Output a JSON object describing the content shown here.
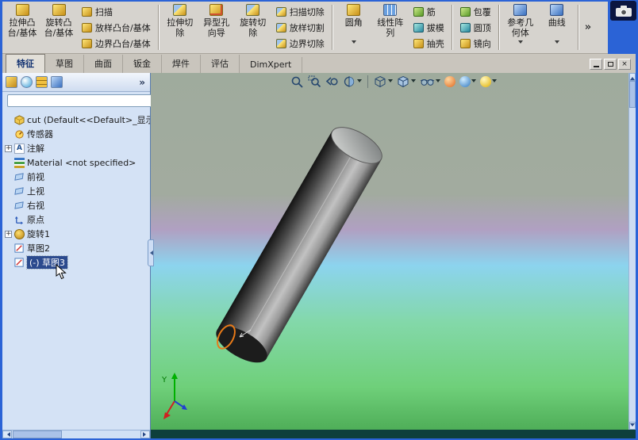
{
  "colors": {
    "window_border": "#2b63d6",
    "ribbon_bg": "#d6d3ce",
    "panel_bg": "#d4e2f5",
    "selection_bg": "#2b4a8e",
    "viewport_gradient": [
      "#9fab9d",
      "#b0a0c2",
      "#8cd4ee",
      "#6fd07a"
    ],
    "sketch_orange": "#e87a18",
    "cylinder_gray": "#8a8a8a"
  },
  "ribbon": {
    "buttons": {
      "extrude_boss": {
        "line1": "拉伸凸",
        "line2": "台/基体"
      },
      "revolve_boss": {
        "line1": "旋转凸",
        "line2": "台/基体"
      },
      "sweep": "扫描",
      "loft": "放样凸台/基体",
      "boundary": "边界凸台/基体",
      "extrude_cut": {
        "line1": "拉伸切",
        "line2": "除"
      },
      "hole_wizard": {
        "line1": "异型孔",
        "line2": "向导"
      },
      "revolve_cut": {
        "line1": "旋转切",
        "line2": "除"
      },
      "sweep_cut": "扫描切除",
      "loft_cut": "放样切割",
      "boundary_cut": "边界切除",
      "fillet": {
        "line1": "圆角",
        "line2": ""
      },
      "linear_pattern": {
        "line1": "线性阵",
        "line2": "列"
      },
      "rib": "筋",
      "draft": "拔模",
      "shell": "抽壳",
      "wrap": "包覆",
      "dome": "圆顶",
      "mirror": "镜向",
      "ref_geometry": {
        "line1": "参考几",
        "line2": "何体"
      },
      "curves": {
        "line1": "曲线",
        "line2": ""
      }
    },
    "overflow_chevron": "»"
  },
  "tabs": {
    "features": "特征",
    "sketch": "草图",
    "surfaces": "曲面",
    "sheet_metal": "钣金",
    "weldments": "焊件",
    "evaluate": "评估",
    "dimxpert": "DimXpert",
    "active": "特征"
  },
  "window_controls": {
    "close": "×"
  },
  "panel": {
    "overflow_chevron": "»",
    "manager_tab_icons": [
      "feature-manager",
      "property-manager",
      "configuration-manager",
      "dimxpert-manager"
    ],
    "filter_value": "",
    "tree": {
      "items": [
        {
          "label": "cut (Default<<Default>_显示",
          "icon": "part",
          "expander": ""
        },
        {
          "label": "传感器",
          "icon": "sensors",
          "expander": ""
        },
        {
          "label": "注解",
          "icon": "annotations",
          "expander": "+"
        },
        {
          "label": "Material <not specified>",
          "icon": "material",
          "expander": ""
        },
        {
          "label": "前视",
          "icon": "plane",
          "expander": ""
        },
        {
          "label": "上视",
          "icon": "plane",
          "expander": ""
        },
        {
          "label": "右视",
          "icon": "plane",
          "expander": ""
        },
        {
          "label": "原点",
          "icon": "origin",
          "expander": ""
        },
        {
          "label": "旋转1",
          "icon": "revolve",
          "expander": "+"
        },
        {
          "label": "草图2",
          "icon": "sketch",
          "expander": ""
        },
        {
          "label": "(-) 草图3",
          "icon": "sketch",
          "expander": "",
          "selected": true
        }
      ]
    }
  },
  "icons": {
    "annotation_glyph": "A"
  },
  "viewport": {
    "hud_icons": [
      "zoom-fit",
      "zoom-area",
      "previous-view",
      "section-view",
      "view-orientation",
      "display-style",
      "hide-show-items",
      "edit-appearance",
      "apply-scene",
      "view-settings"
    ],
    "triad_y_label": "Y"
  }
}
